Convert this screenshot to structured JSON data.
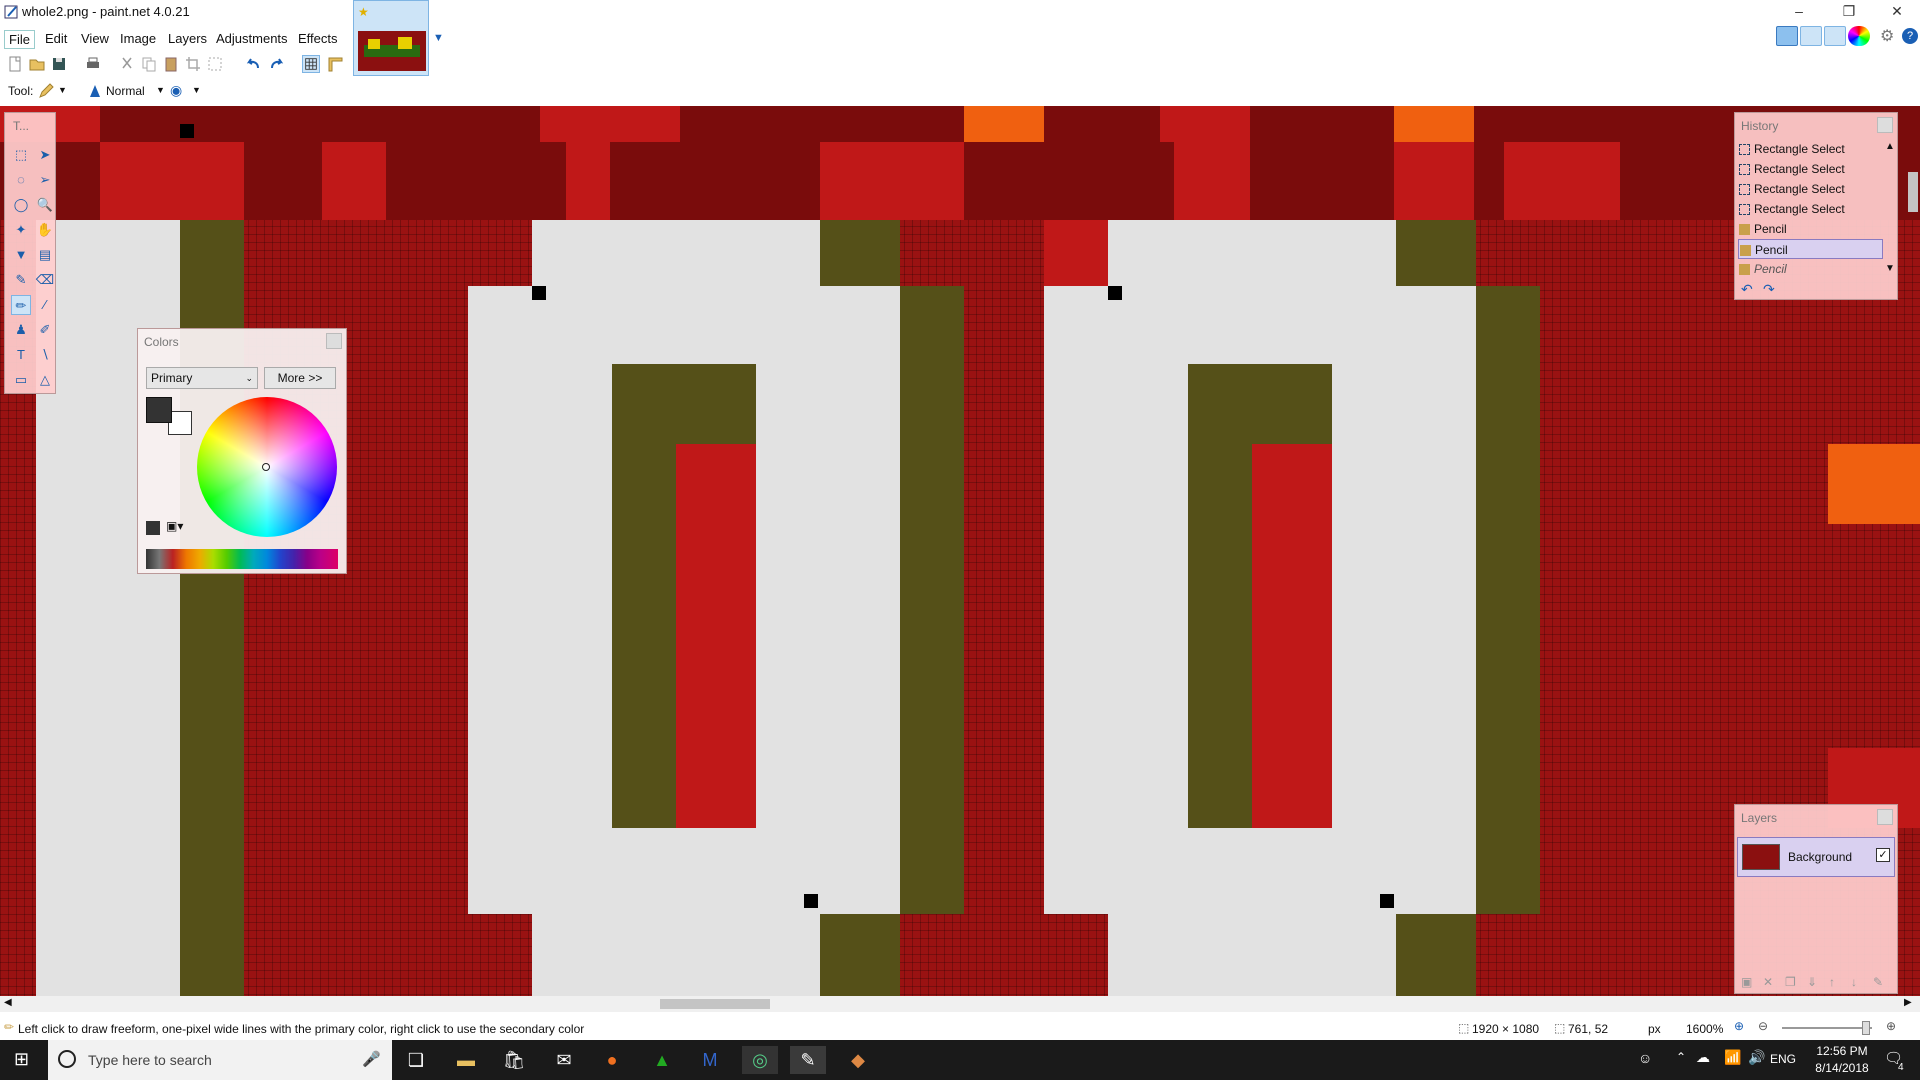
{
  "window": {
    "title": "whole2.png - paint.net 4.0.21",
    "controls": [
      "–",
      "❐",
      "✕"
    ]
  },
  "menu": [
    "File",
    "Edit",
    "View",
    "Image",
    "Layers",
    "Adjustments",
    "Effects"
  ],
  "toolrow": {
    "tool_label": "Tool:",
    "blend_mode": "Normal"
  },
  "icons": {
    "toolbar": [
      "new-icon",
      "open-icon",
      "save-icon",
      "print-icon",
      "cut-icon",
      "copy-icon",
      "paste-icon",
      "crop-icon",
      "deselect-icon",
      "undo-icon",
      "redo-icon",
      "grid-icon",
      "ruler-icon"
    ]
  },
  "tools_panel": {
    "title": "T...",
    "tools": [
      "rectangle-select-icon",
      "move-selection-icon",
      "lasso-icon",
      "move-pixels-icon",
      "ellipse-select-icon",
      "zoom-icon",
      "magic-wand-icon",
      "pan-icon",
      "paint-bucket-icon",
      "gradient-icon",
      "paintbrush-icon",
      "eraser-icon",
      "pencil-icon",
      "color-picker-icon",
      "clone-stamp-icon",
      "recolor-icon",
      "text-icon",
      "line-curve-icon",
      "shapes-icon"
    ]
  },
  "colors_panel": {
    "title": "Colors",
    "mode": "Primary",
    "more_label": "More >>",
    "primary": "#333333",
    "secondary": "#ffffff"
  },
  "history_panel": {
    "title": "History",
    "items": [
      "Rectangle Select",
      "Rectangle Select",
      "Rectangle Select",
      "Rectangle Select",
      "Pencil",
      "Pencil",
      "Pencil"
    ],
    "selected_index": 5
  },
  "layers_panel": {
    "title": "Layers",
    "layer_name": "Background",
    "visible": true
  },
  "status": {
    "hint": "Left click to draw freeform, one-pixel wide lines with the primary color, right click to use the secondary color",
    "image_size": "1920 × 1080",
    "cursor": "761, 52",
    "units": "px",
    "zoom": "1600%"
  },
  "taskbar": {
    "search_placeholder": "Type here to search",
    "time": "12:56 PM",
    "date": "8/14/2018",
    "lang": "ENG",
    "notifications": "4"
  },
  "colors": {
    "dark_red": "#9a1212",
    "bright_red": "#c01818",
    "olive": "#555018",
    "light_gray": "#e2e2e2",
    "orange": "#f06010"
  }
}
